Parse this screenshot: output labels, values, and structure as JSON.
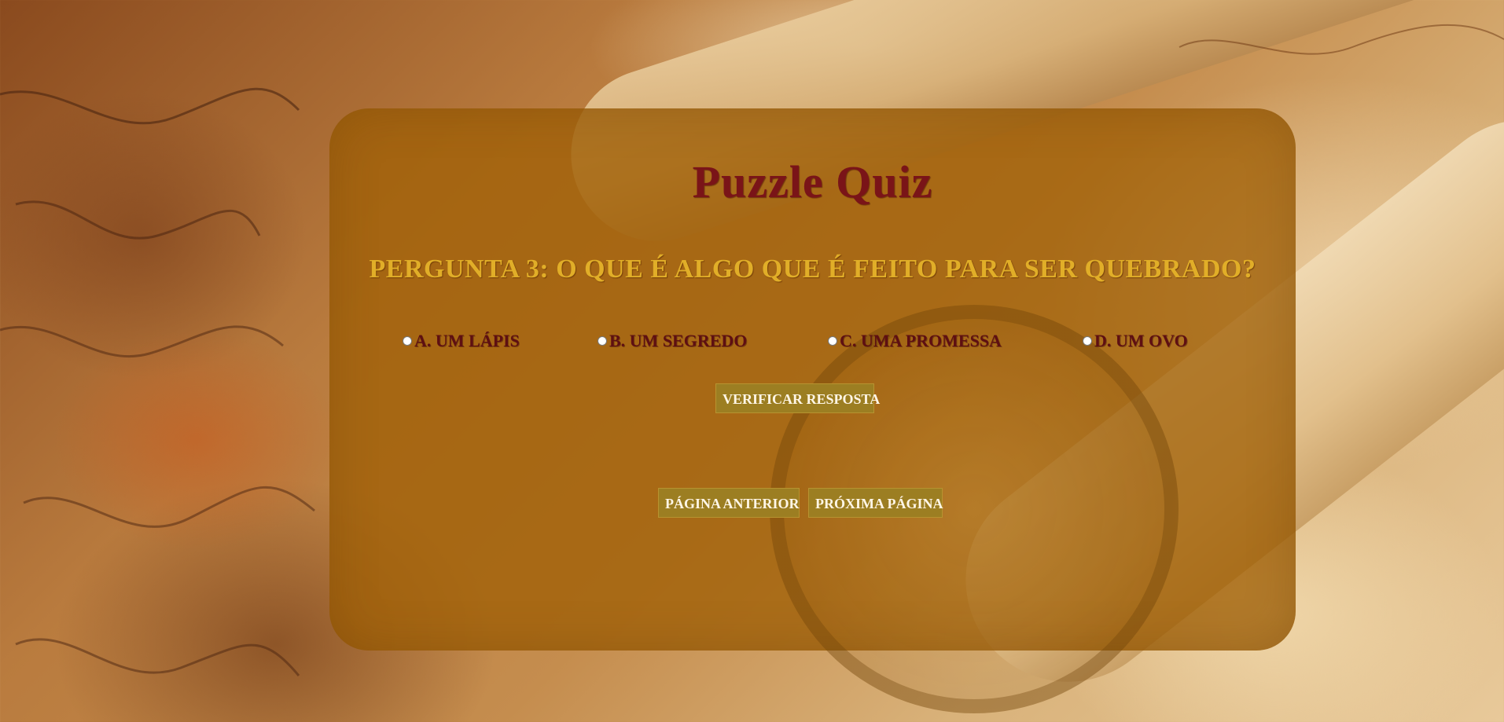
{
  "page": {
    "title": "Puzzle Quiz"
  },
  "quiz": {
    "question": "Pergunta 3: O que é algo que é feito para ser quebrado?",
    "options": [
      {
        "label": "A. Um lápis",
        "selected": false
      },
      {
        "label": "B. Um segredo",
        "selected": false
      },
      {
        "label": "C. Uma promessa",
        "selected": false
      },
      {
        "label": "D. Um ovo",
        "selected": false
      }
    ],
    "verify_label": "Verificar Resposta"
  },
  "navigation": {
    "prev_label": "Página Anterior",
    "next_label": "Próxima Página"
  },
  "theme": {
    "title_color": "#7a1418",
    "question_color": "#e1ae28",
    "option_color": "#5e0f12",
    "button_color": "#9c7e22",
    "card_color": "#a06006"
  }
}
